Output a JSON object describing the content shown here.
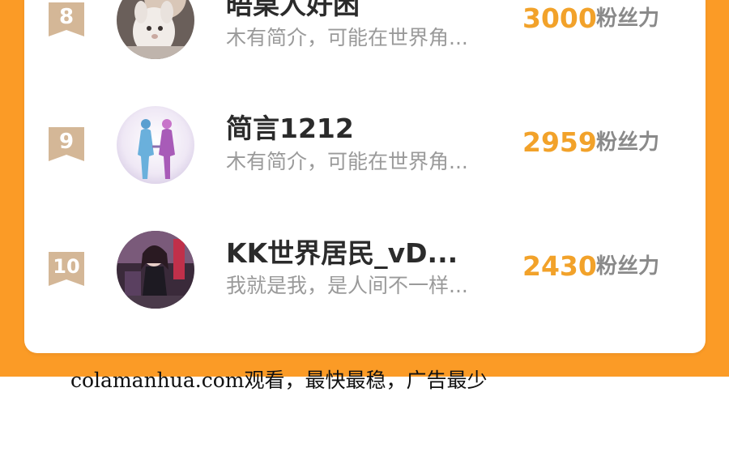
{
  "ranking": {
    "rows": [
      {
        "rank": "8",
        "name": "晤桌人好困",
        "bio": "木有简介，可能在世界角...",
        "score": "3000",
        "unit": "粉丝力",
        "avatar_icon": "plush-toy-avatar"
      },
      {
        "rank": "9",
        "name": "简言1212",
        "bio": "木有简介，可能在世界角...",
        "score": "2959",
        "unit": "粉丝力",
        "avatar_icon": "couple-silhouette-avatar"
      },
      {
        "rank": "10",
        "name": "KK世界居民_vD...",
        "bio": "我就是我，是人间不一样...",
        "score": "2430",
        "unit": "粉丝力",
        "avatar_icon": "anime-girl-avatar"
      }
    ]
  },
  "footer": {
    "text": "colamanhua.com观看，最快最稳，广告最少"
  },
  "colors": {
    "accent": "#fb9b26",
    "score": "#f2a22a",
    "badge": "#d4b797"
  }
}
